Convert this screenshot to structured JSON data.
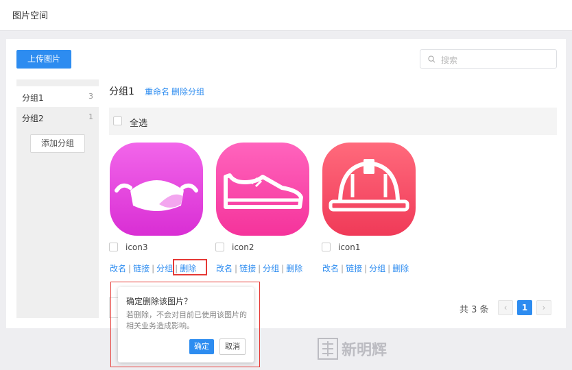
{
  "header": {
    "title": "图片空间"
  },
  "toolbar": {
    "upload_label": "上传图片",
    "search_placeholder": "搜索"
  },
  "sidebar": {
    "groups": [
      {
        "label": "分组1",
        "count": "3"
      },
      {
        "label": "分组2",
        "count": "1"
      }
    ],
    "add_group_label": "添加分组"
  },
  "main": {
    "group_title": "分组1",
    "rename_label": "重命名",
    "delete_group_label": "删除分组",
    "select_all_label": "全选",
    "images": [
      {
        "name": "icon3",
        "color_top": "#f05ce6",
        "color_bottom": "#d92ed4",
        "icon": "mask-icon"
      },
      {
        "name": "icon2",
        "color_top": "#ff5fb8",
        "color_bottom": "#f5339b",
        "icon": "shoe-icon"
      },
      {
        "name": "icon1",
        "color_top": "#ff6477",
        "color_bottom": "#f03a58",
        "icon": "helmet-icon"
      }
    ],
    "actions": {
      "rename": "改名",
      "link": "链接",
      "group": "分组",
      "delete": "删除"
    }
  },
  "popover": {
    "question": "确定删除该图片？",
    "description": "若删除，不会对目前已使用该图片的相关业务造成影响。",
    "confirm_label": "确定",
    "cancel_label": "取消"
  },
  "pagination": {
    "total_text": "共 3 条",
    "current_page": "1",
    "prev": "‹",
    "next": "›"
  },
  "watermark": {
    "text": "新明辉"
  },
  "colors": {
    "accent": "#2d8cf0",
    "highlight": "#e53935"
  }
}
